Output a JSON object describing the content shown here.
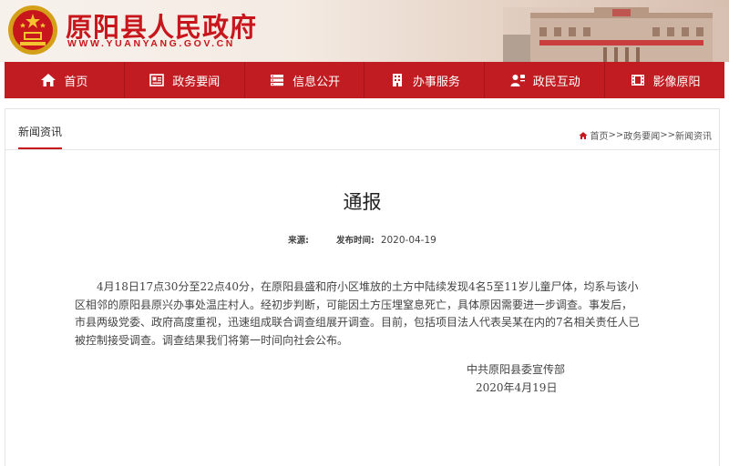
{
  "header": {
    "site_title": "原阳县人民政府",
    "site_url": "WWW.YUANYANG.GOV.CN",
    "brand_red": "#c8161d"
  },
  "nav": [
    {
      "label": "首页",
      "icon": "home-icon"
    },
    {
      "label": "政务要闻",
      "icon": "newspaper-icon"
    },
    {
      "label": "信息公开",
      "icon": "database-icon"
    },
    {
      "label": "办事服务",
      "icon": "building-icon"
    },
    {
      "label": "政民互动",
      "icon": "user-chat-icon"
    },
    {
      "label": "影像原阳",
      "icon": "film-icon"
    }
  ],
  "tab": {
    "label": "新闻资讯"
  },
  "breadcrumb": {
    "home": "首页",
    "sep1": ">>",
    "section": "政务要闻",
    "sep2": ">>",
    "current": "新闻资讯"
  },
  "article": {
    "title": "通报",
    "source_label": "来源:",
    "source_value": "",
    "time_label": "发布时间:",
    "time_value": "2020-04-19",
    "body": "4月18日17点30分至22点40分，在原阳县盛和府小区堆放的土方中陆续发现4名5至11岁儿童尸体，均系与该小区相邻的原阳县原兴办事处温庄村人。经初步判断，可能因土方压埋窒息死亡，具体原因需要进一步调查。事发后，市县两级党委、政府高度重视，迅速组成联合调查组展开调查。目前，包括项目法人代表吴某在内的7名相关责任人已被控制接受调查。调查结果我们将第一时间向社会公布。",
    "signature_org": "中共原阳县委宣传部",
    "signature_date": "2020年4月19日"
  }
}
